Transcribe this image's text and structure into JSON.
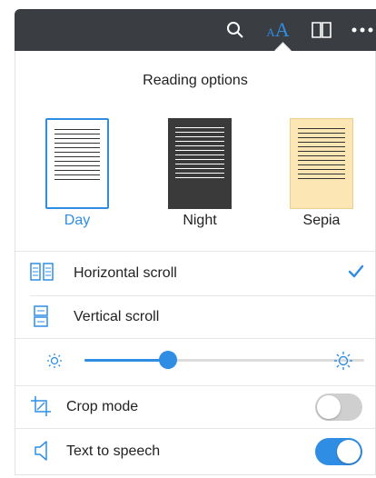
{
  "panel": {
    "title": "Reading options"
  },
  "themes": [
    {
      "label": "Day",
      "selected": true,
      "bg": "#ffffff",
      "line": "#333333",
      "border": "#2f8de4",
      "text_color": "#2f8de4"
    },
    {
      "label": "Night",
      "selected": false,
      "bg": "#3a3a3a",
      "line": "#ffffff",
      "border": "#3a3a3a",
      "text_color": "#222222"
    },
    {
      "label": "Sepia",
      "selected": false,
      "bg": "#fbe6b4",
      "line": "#333333",
      "border": "#e8cf8f",
      "text_color": "#222222"
    }
  ],
  "scroll_options": [
    {
      "label": "Horizontal scroll",
      "icon": "horizontal-scroll-icon",
      "selected": true
    },
    {
      "label": "Vertical scroll",
      "icon": "vertical-scroll-icon",
      "selected": false
    }
  ],
  "brightness": {
    "value": 0.3
  },
  "toggles": [
    {
      "label": "Crop mode",
      "icon": "crop-icon",
      "on": false
    },
    {
      "label": "Text to speech",
      "icon": "speaker-icon",
      "on": true
    }
  ],
  "colors": {
    "accent": "#2f8de4",
    "toolbar": "#3a3d42",
    "toggle_off": "#cfcfcf"
  }
}
